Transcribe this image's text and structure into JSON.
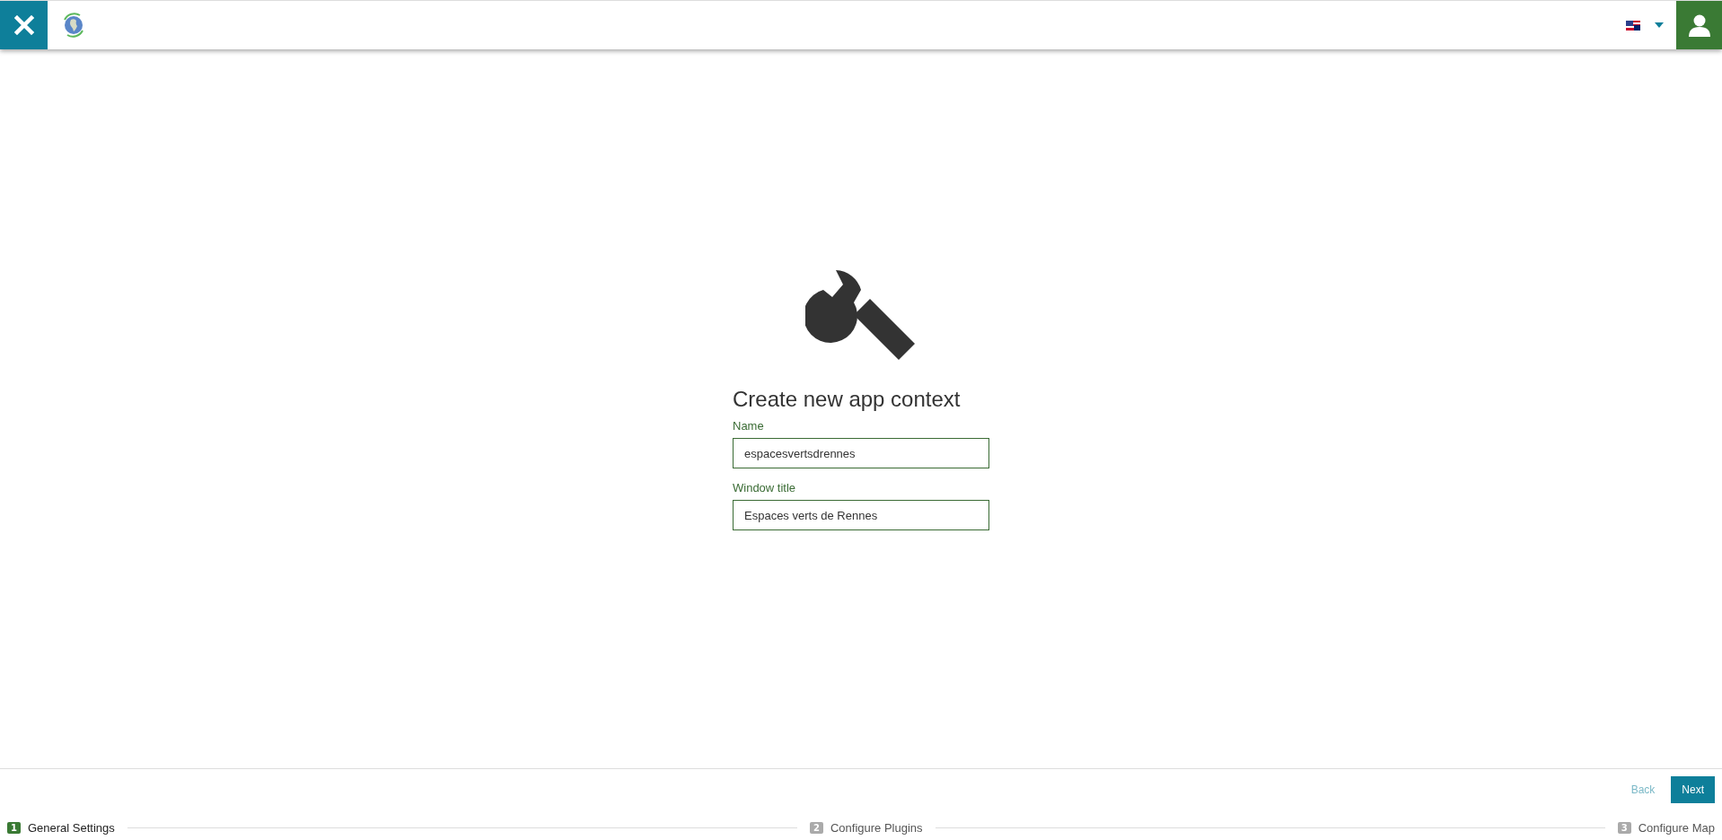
{
  "header": {
    "language_menu": {
      "expanded": false
    }
  },
  "form": {
    "title": "Create new app context",
    "fields": [
      {
        "label": "Name",
        "value": "espacesvertsdrennes"
      },
      {
        "label": "Window title",
        "value": "Espaces verts de Rennes"
      }
    ]
  },
  "buttons": [
    {
      "kind": "back",
      "label": "Back",
      "disabled": true
    },
    {
      "kind": "next",
      "label": "Next",
      "disabled": false
    }
  ],
  "steps": [
    {
      "number": "1",
      "label": "General Settings",
      "selected": true
    },
    {
      "number": "2",
      "label": "Configure Plugins",
      "selected": false
    },
    {
      "number": "3",
      "label": "Configure Map",
      "selected": false
    }
  ]
}
